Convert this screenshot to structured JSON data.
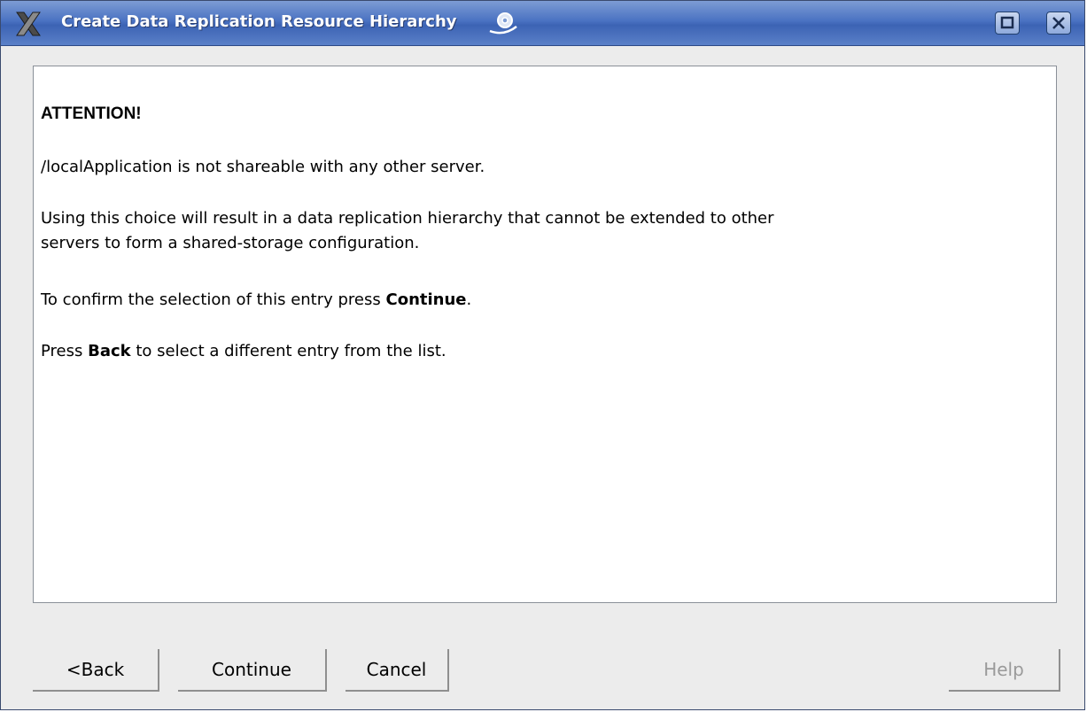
{
  "window": {
    "title": "Create Data Replication Resource Hierarchy",
    "app_icon": "x-window-icon",
    "sticky_icon": "sticky-pin-icon",
    "controls": [
      {
        "name": "maximize",
        "icon": "maximize-icon"
      },
      {
        "name": "close",
        "icon": "close-icon"
      }
    ]
  },
  "message": {
    "heading": "ATTENTION!",
    "line1": "/localApplication is not shareable with any other server.",
    "line2a": "Using this choice will result in a data replication hierarchy that cannot be extended to other",
    "line2b": "servers to form a shared-storage configuration.",
    "line3_prefix": "To confirm the selection of this entry press ",
    "line3_bold": "Continue",
    "line3_suffix": ".",
    "line4_prefix": "Press ",
    "line4_bold": "Back",
    "line4_suffix": " to select a different entry from the list."
  },
  "buttons": {
    "back": "<Back",
    "continue": "Continue",
    "cancel": "Cancel",
    "help": "Help"
  },
  "colors": {
    "titlebar": "#4a72c2",
    "title_text": "#ffffff",
    "disabled_text": "#9a9a9a"
  }
}
